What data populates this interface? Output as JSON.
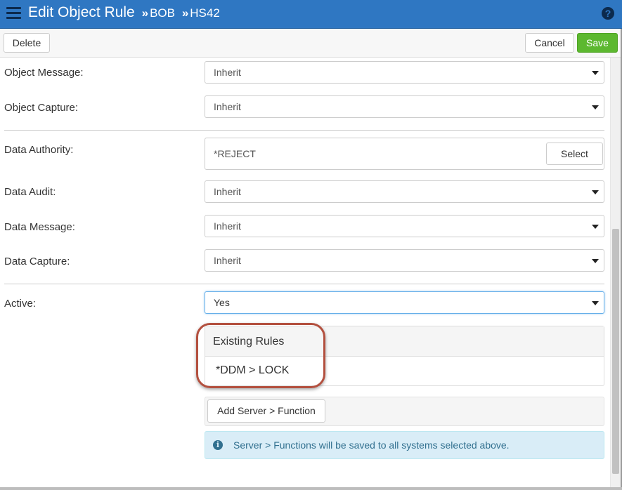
{
  "header": {
    "title": "Edit Object Rule",
    "separator": "»",
    "crumbs": [
      "BOB",
      "HS42"
    ],
    "help_label": "?"
  },
  "toolbar": {
    "delete_label": "Delete",
    "cancel_label": "Cancel",
    "save_label": "Save"
  },
  "form": {
    "object_message": {
      "label": "Object Message:",
      "value": "Inherit"
    },
    "object_capture": {
      "label": "Object Capture:",
      "value": "Inherit"
    },
    "data_authority": {
      "label": "Data Authority:",
      "value": "*REJECT",
      "select_label": "Select"
    },
    "data_audit": {
      "label": "Data Audit:",
      "value": "Inherit"
    },
    "data_message": {
      "label": "Data Message:",
      "value": "Inherit"
    },
    "data_capture": {
      "label": "Data Capture:",
      "value": "Inherit"
    },
    "active": {
      "label": "Active:",
      "value": "Yes"
    }
  },
  "existing_rules": {
    "heading": "Existing Rules",
    "items": [
      "*DDM > LOCK"
    ]
  },
  "add_server": {
    "label": "Add Server > Function"
  },
  "info": {
    "icon": "info-icon",
    "text": "Server > Functions will be saved to all systems selected above."
  },
  "colors": {
    "header_bg": "#2f77c2",
    "save_bg": "#5cb82f",
    "highlight_ring": "#b3503f",
    "info_bg": "#d9edf7",
    "info_text": "#31708f"
  }
}
